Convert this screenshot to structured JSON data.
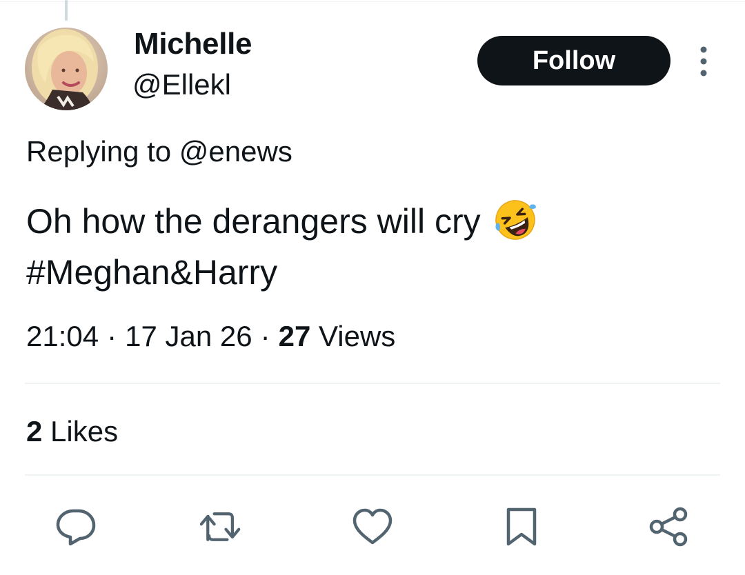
{
  "tweet": {
    "author": {
      "display_name": "Michelle",
      "handle": "@Ellekl"
    },
    "follow_label": "Follow",
    "replying_prefix": "Replying to",
    "replying_to": "@enews",
    "text_line1": "Oh how the derangers will cry",
    "emoji": "rolling-on-the-floor-laughing-emoji",
    "text_line2": "#Meghan&Harry",
    "time": "21:04",
    "date": "17 Jan 26",
    "views_count": "27",
    "views_label": "Views",
    "likes_count": "2",
    "likes_label": "Likes"
  },
  "actions": {
    "icons": [
      "reply-icon",
      "retweet-icon",
      "like-icon",
      "bookmark-icon",
      "share-icon"
    ]
  },
  "colors": {
    "text": "#0f1419",
    "icon_gray": "#536471",
    "divider": "#eff3f4",
    "button_bg": "#0f1419"
  }
}
